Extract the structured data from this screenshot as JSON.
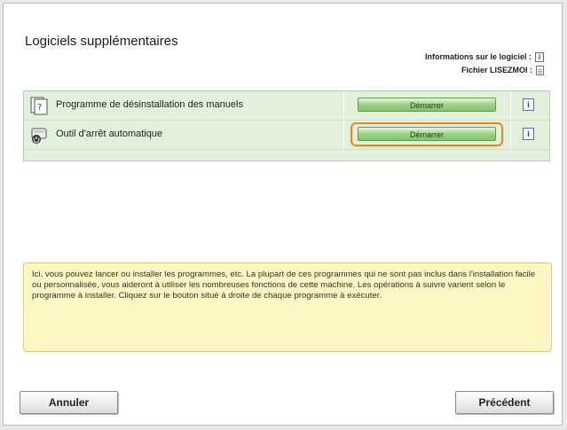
{
  "dialog": {
    "title": "Logiciels supplémentaires",
    "info_links": {
      "software_info_label": "Informations sur le logiciel :",
      "readme_label": "Fichier LISEZMOI :"
    },
    "programs": [
      {
        "name": "Programme de désinstallation des manuels",
        "button_label": "Démarrer",
        "icon": "uninstall-manual-icon"
      },
      {
        "name": "Outil d'arrêt automatique",
        "button_label": "Démarrer",
        "icon": "auto-shutdown-tool-icon"
      }
    ],
    "description": "Ici, vous pouvez lancer ou installer les programmes, etc. La plupart de ces programmes qui ne sont pas inclus dans l'installation facile ou personnalisée, vous aideront à utiliser les nombreuses fonctions de cette machine. Les opérations à suivre varient selon le programme à installer. Cliquez sur le bouton situé à droite de chaque programme à exécuter.",
    "buttons": {
      "cancel": "Annuler",
      "previous": "Précédent"
    }
  },
  "colors": {
    "row_bg": "#e3f0dc",
    "start_button": "#9dd283",
    "highlight": "#ee8522",
    "description_bg": "#fbf6c4"
  }
}
